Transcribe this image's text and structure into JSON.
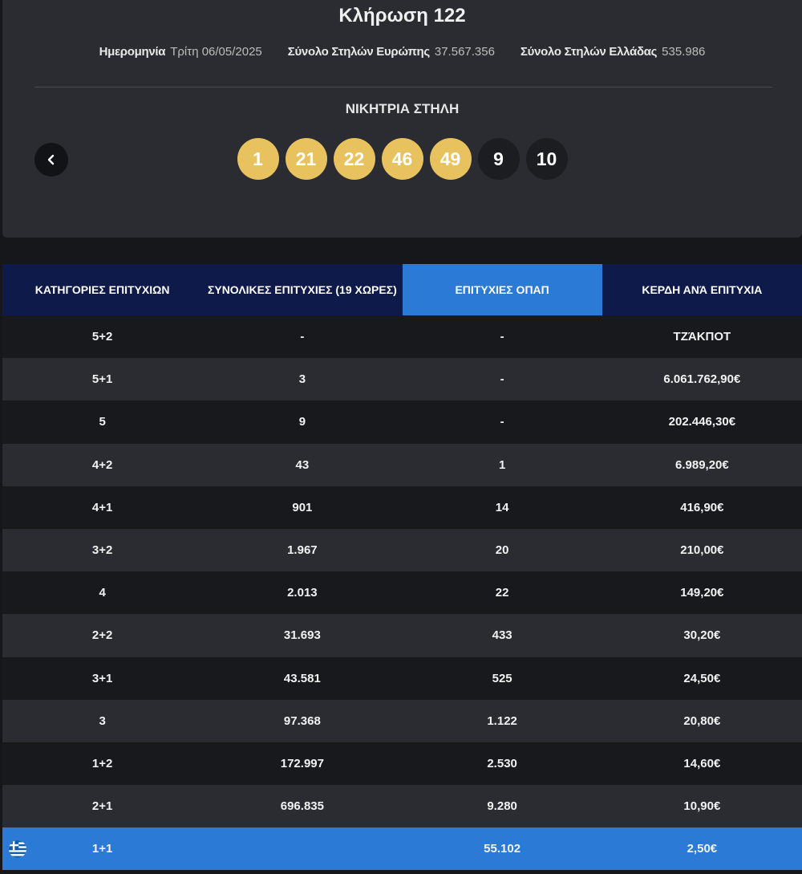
{
  "draw": {
    "title": "Κλήρωση 122",
    "date_label": "Ημερομηνία",
    "date_value": "Τρίτη 06/05/2025",
    "europe_label": "Σύνολο Στηλών Ευρώπης",
    "europe_value": "37.567.356",
    "greece_label": "Σύνολο Στηλών Ελλάδας",
    "greece_value": "535.986"
  },
  "winning": {
    "title": "ΝΙΚΗΤΡΙΑ ΣΤΗΛΗ",
    "prev_icon": "chevron-left-icon",
    "main_numbers": [
      "1",
      "21",
      "22",
      "46",
      "49"
    ],
    "extra_numbers": [
      "9",
      "10"
    ],
    "main_color": "#e8c25f",
    "extra_color": "#1c1d21"
  },
  "table": {
    "headers": [
      "ΚΑΤΗΓΟΡΙΕΣ ΕΠΙΤΥΧΙΩΝ",
      "ΣΥΝΟΛΙΚΕΣ ΕΠΙΤΥΧΙΕΣ (19 ΧΩΡΕΣ)",
      "ΕΠΙΤΥΧΙΕΣ ΟΠΑΠ",
      "ΚΕΡΔΗ ΑΝΆ ΕΠΙΤΥΧΙΑ"
    ],
    "active_header_color": "#2b7bd6",
    "rows": [
      [
        "5+2",
        "-",
        "-",
        "ΤΖΆΚΠΟΤ"
      ],
      [
        "5+1",
        "3",
        "-",
        "6.061.762,90€"
      ],
      [
        "5",
        "9",
        "-",
        "202.446,30€"
      ],
      [
        "4+2",
        "43",
        "1",
        "6.989,20€"
      ],
      [
        "4+1",
        "901",
        "14",
        "416,90€"
      ],
      [
        "3+2",
        "1.967",
        "20",
        "210,00€"
      ],
      [
        "4",
        "2.013",
        "22",
        "149,20€"
      ],
      [
        "2+2",
        "31.693",
        "433",
        "30,20€"
      ],
      [
        "3+1",
        "43.581",
        "525",
        "24,50€"
      ],
      [
        "3",
        "97.368",
        "1.122",
        "20,80€"
      ],
      [
        "1+2",
        "172.997",
        "2.530",
        "14,60€"
      ],
      [
        "2+1",
        "696.835",
        "9.280",
        "10,90€"
      ]
    ],
    "highlight_row": {
      "flag_icon": "greek-flag-icon",
      "cells": [
        "1+1",
        "",
        "55.102",
        "2,50€"
      ]
    }
  }
}
